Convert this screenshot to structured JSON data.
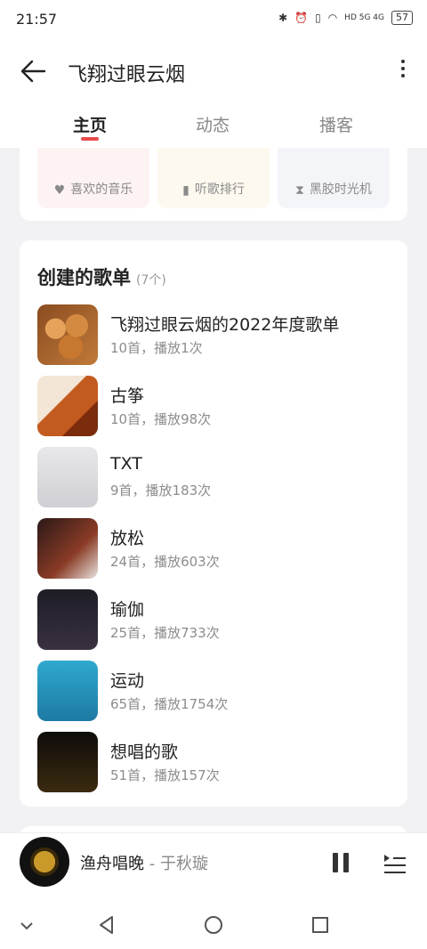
{
  "status": {
    "time": "21:57",
    "network": "HD 5G 4G",
    "battery": "57"
  },
  "header": {
    "title": "飞翔过眼云烟"
  },
  "tabs": [
    {
      "label": "主页"
    },
    {
      "label": "动态"
    },
    {
      "label": "播客"
    }
  ],
  "quick_links": [
    {
      "label": "喜欢的音乐",
      "icon": "heart-icon"
    },
    {
      "label": "听歌排行",
      "icon": "bar-chart-icon"
    },
    {
      "label": "黑胶时光机",
      "icon": "hourglass-icon"
    }
  ],
  "playlists": {
    "heading": "创建的歌单",
    "count": "(7个)",
    "items": [
      {
        "name": "飞翔过眼云烟的2022年度歌单",
        "sub": "10首，播放1次"
      },
      {
        "name": "古筝",
        "sub": "10首，播放98次"
      },
      {
        "name": "TXT",
        "sub": "9首，播放183次"
      },
      {
        "name": "放松",
        "sub": "24首，播放603次"
      },
      {
        "name": "瑜伽",
        "sub": "25首，播放733次"
      },
      {
        "name": "运动",
        "sub": "65首，播放1754次"
      },
      {
        "name": "想唱的歌",
        "sub": "51首，播放157次"
      }
    ]
  },
  "player": {
    "song": "渔舟唱晚",
    "artist": " - 于秋璇"
  }
}
